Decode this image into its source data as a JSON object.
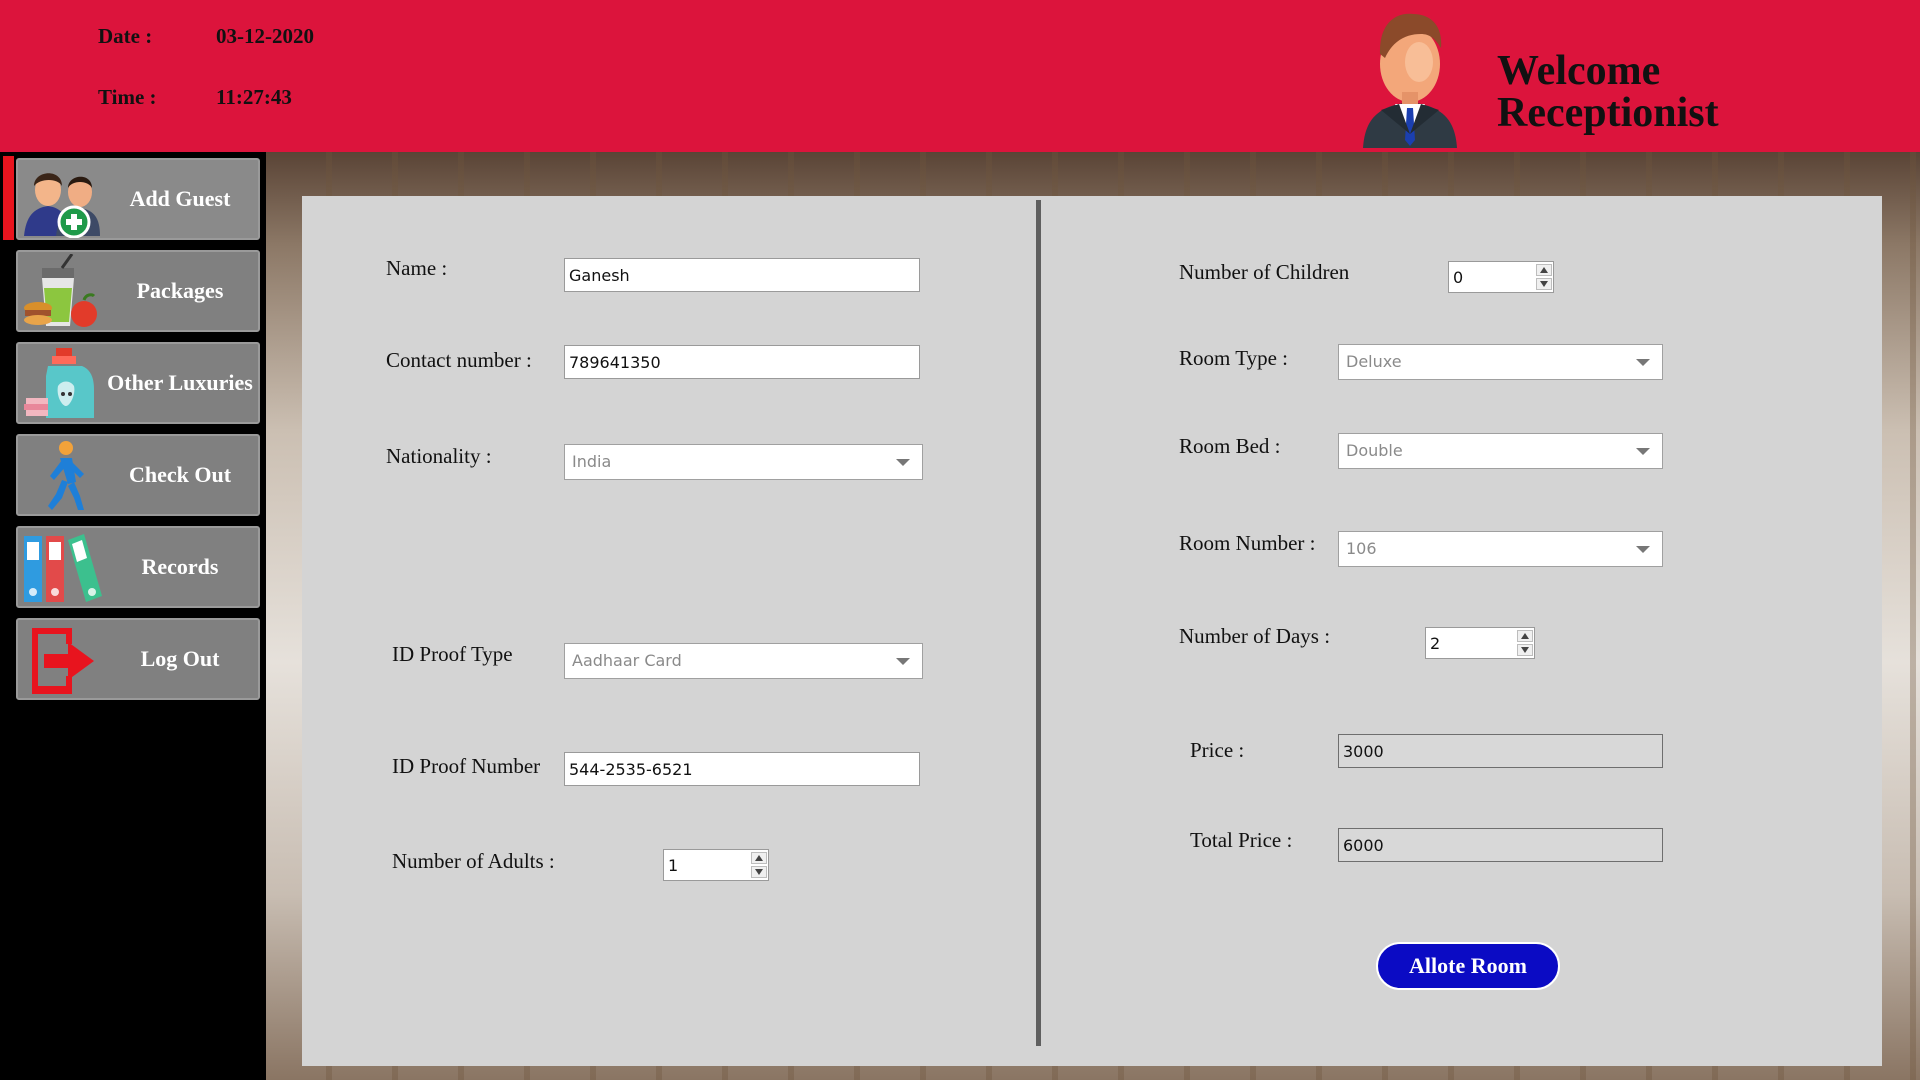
{
  "header": {
    "date_label": "Date :",
    "date_value": "03-12-2020",
    "time_label": "Time :",
    "time_value": "11:27:43",
    "welcome_line1": "Welcome",
    "welcome_line2": "Receptionist"
  },
  "sidebar": {
    "items": [
      {
        "label": "Add Guest",
        "icon": "add-guest-icon",
        "active": true
      },
      {
        "label": "Packages",
        "icon": "packages-icon"
      },
      {
        "label": "Other Luxuries",
        "icon": "other-luxuries-icon"
      },
      {
        "label": "Check Out",
        "icon": "check-out-icon"
      },
      {
        "label": "Records",
        "icon": "records-icon"
      },
      {
        "label": "Log Out",
        "icon": "log-out-icon"
      }
    ]
  },
  "form": {
    "name": {
      "label": "Name :",
      "value": "Ganesh"
    },
    "contact": {
      "label": "Contact number :",
      "value": "789641350"
    },
    "nationality": {
      "label": "Nationality :",
      "value": "India"
    },
    "id_proof_type": {
      "label": "ID Proof Type",
      "value": "Aadhaar Card"
    },
    "id_proof_number": {
      "label": "ID Proof Number",
      "value": "544-2535-6521"
    },
    "adults": {
      "label": "Number of Adults :",
      "value": "1"
    },
    "children": {
      "label": "Number of Children",
      "value": "0"
    },
    "room_type": {
      "label": "Room Type :",
      "value": "Deluxe"
    },
    "room_bed": {
      "label": "Room Bed :",
      "value": "Double"
    },
    "room_number": {
      "label": "Room Number :",
      "value": "106"
    },
    "days": {
      "label": "Number of Days :",
      "value": "2"
    },
    "price": {
      "label": "Price :",
      "value": "3000"
    },
    "total_price": {
      "label": "Total Price :",
      "value": "6000"
    },
    "submit_label": "Allote Room"
  },
  "colors": {
    "header_bg": "#dc143c",
    "sidebar_bg": "#000000",
    "sidebar_button": "#808080",
    "panel_bg": "#d4d4d4",
    "primary_button": "#0b0bc4"
  }
}
